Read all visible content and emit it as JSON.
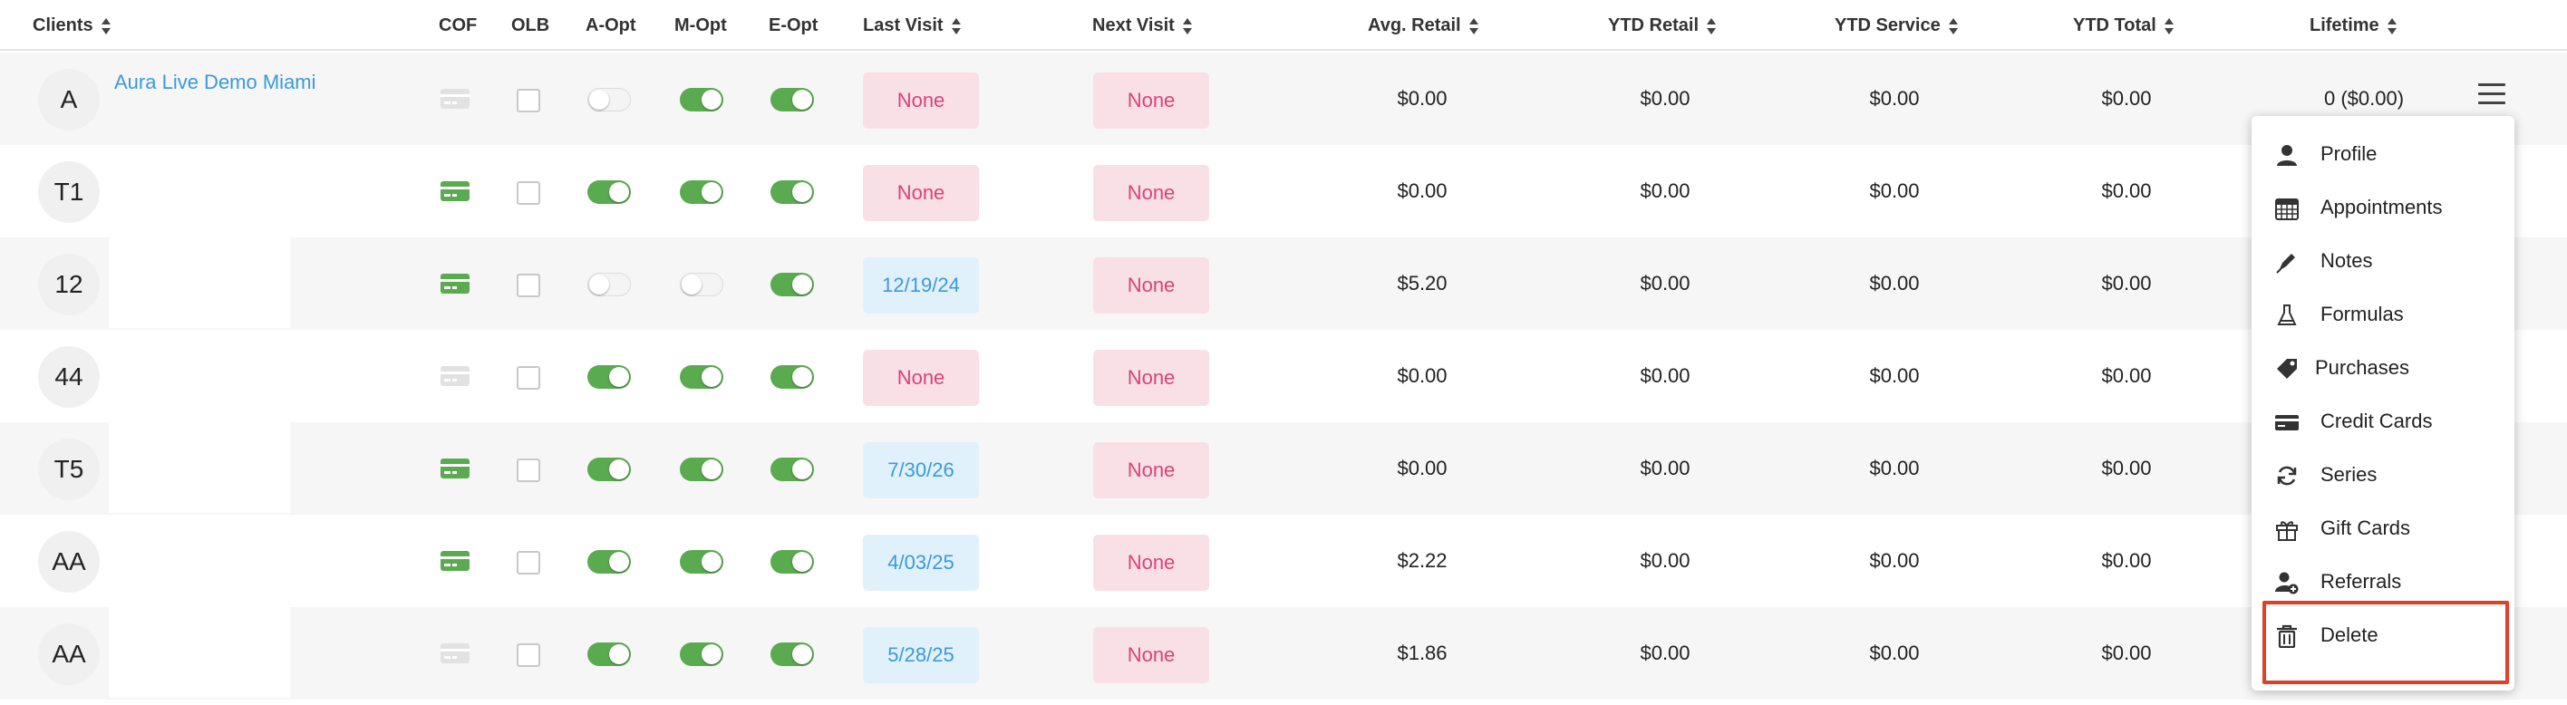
{
  "columns": {
    "clients": "Clients",
    "cof": "COF",
    "olb": "OLB",
    "a_opt": "A-Opt",
    "m_opt": "M-Opt",
    "e_opt": "E-Opt",
    "last_visit": "Last Visit",
    "next_visit": "Next Visit",
    "avg_retail": "Avg. Retail",
    "ytd_retail": "YTD Retail",
    "ytd_service": "YTD Service",
    "ytd_total": "YTD Total",
    "lifetime": "Lifetime"
  },
  "rows": [
    {
      "initials": "A",
      "name": "Aura Live Demo Miami",
      "cof": false,
      "olb": false,
      "a_opt": false,
      "m_opt": true,
      "e_opt": true,
      "last_visit": "None",
      "next_visit": "None",
      "avg_retail": "$0.00",
      "ytd_retail": "$0.00",
      "ytd_service": "$0.00",
      "ytd_total": "$0.00",
      "lifetime": "0 ($0.00)"
    },
    {
      "initials": "T1",
      "name": "",
      "cof": true,
      "olb": false,
      "a_opt": true,
      "m_opt": true,
      "e_opt": true,
      "last_visit": "None",
      "next_visit": "None",
      "avg_retail": "$0.00",
      "ytd_retail": "$0.00",
      "ytd_service": "$0.00",
      "ytd_total": "$0.00",
      "lifetime": ""
    },
    {
      "initials": "12",
      "name": "",
      "cof": true,
      "olb": false,
      "a_opt": false,
      "m_opt": false,
      "e_opt": true,
      "last_visit": "12/19/24",
      "next_visit": "None",
      "avg_retail": "$5.20",
      "ytd_retail": "$0.00",
      "ytd_service": "$0.00",
      "ytd_total": "$0.00",
      "lifetime": ""
    },
    {
      "initials": "44",
      "name": "",
      "cof": false,
      "olb": false,
      "a_opt": true,
      "m_opt": true,
      "e_opt": true,
      "last_visit": "None",
      "next_visit": "None",
      "avg_retail": "$0.00",
      "ytd_retail": "$0.00",
      "ytd_service": "$0.00",
      "ytd_total": "$0.00",
      "lifetime": ""
    },
    {
      "initials": "T5",
      "name": "",
      "cof": true,
      "olb": false,
      "a_opt": true,
      "m_opt": true,
      "e_opt": true,
      "last_visit": "7/30/26",
      "next_visit": "None",
      "avg_retail": "$0.00",
      "ytd_retail": "$0.00",
      "ytd_service": "$0.00",
      "ytd_total": "$0.00",
      "lifetime": ""
    },
    {
      "initials": "AA",
      "name": "",
      "cof": true,
      "olb": false,
      "a_opt": true,
      "m_opt": true,
      "e_opt": true,
      "last_visit": "4/03/25",
      "next_visit": "None",
      "avg_retail": "$2.22",
      "ytd_retail": "$0.00",
      "ytd_service": "$0.00",
      "ytd_total": "$0.00",
      "lifetime": ""
    },
    {
      "initials": "AA",
      "name": "",
      "cof": false,
      "olb": false,
      "a_opt": true,
      "m_opt": true,
      "e_opt": true,
      "last_visit": "5/28/25",
      "next_visit": "None",
      "avg_retail": "$1.86",
      "ytd_retail": "$0.00",
      "ytd_service": "$0.00",
      "ytd_total": "$0.00",
      "lifetime": ""
    }
  ],
  "menu": {
    "items": [
      {
        "label": "Profile",
        "icon": "user-icon"
      },
      {
        "label": "Appointments",
        "icon": "calendar-icon"
      },
      {
        "label": "Notes",
        "icon": "pen-icon"
      },
      {
        "label": "Formulas",
        "icon": "flask-icon"
      },
      {
        "label": "Purchases",
        "icon": "tag-icon"
      },
      {
        "label": "Credit Cards",
        "icon": "credit-card-icon"
      },
      {
        "label": "Series",
        "icon": "refresh-icon"
      },
      {
        "label": "Gift Cards",
        "icon": "gift-icon"
      },
      {
        "label": "Referrals",
        "icon": "user-plus-icon"
      },
      {
        "label": "Delete",
        "icon": "trash-icon"
      }
    ]
  },
  "colors": {
    "accent_blue": "#3a9ad9",
    "toggle_on": "#5aaa4f",
    "none_pill_bg": "#f9e0e6",
    "none_pill_text": "#d9437a",
    "date_pill_bg": "#e1f1fb",
    "highlight": "#e0402a"
  }
}
